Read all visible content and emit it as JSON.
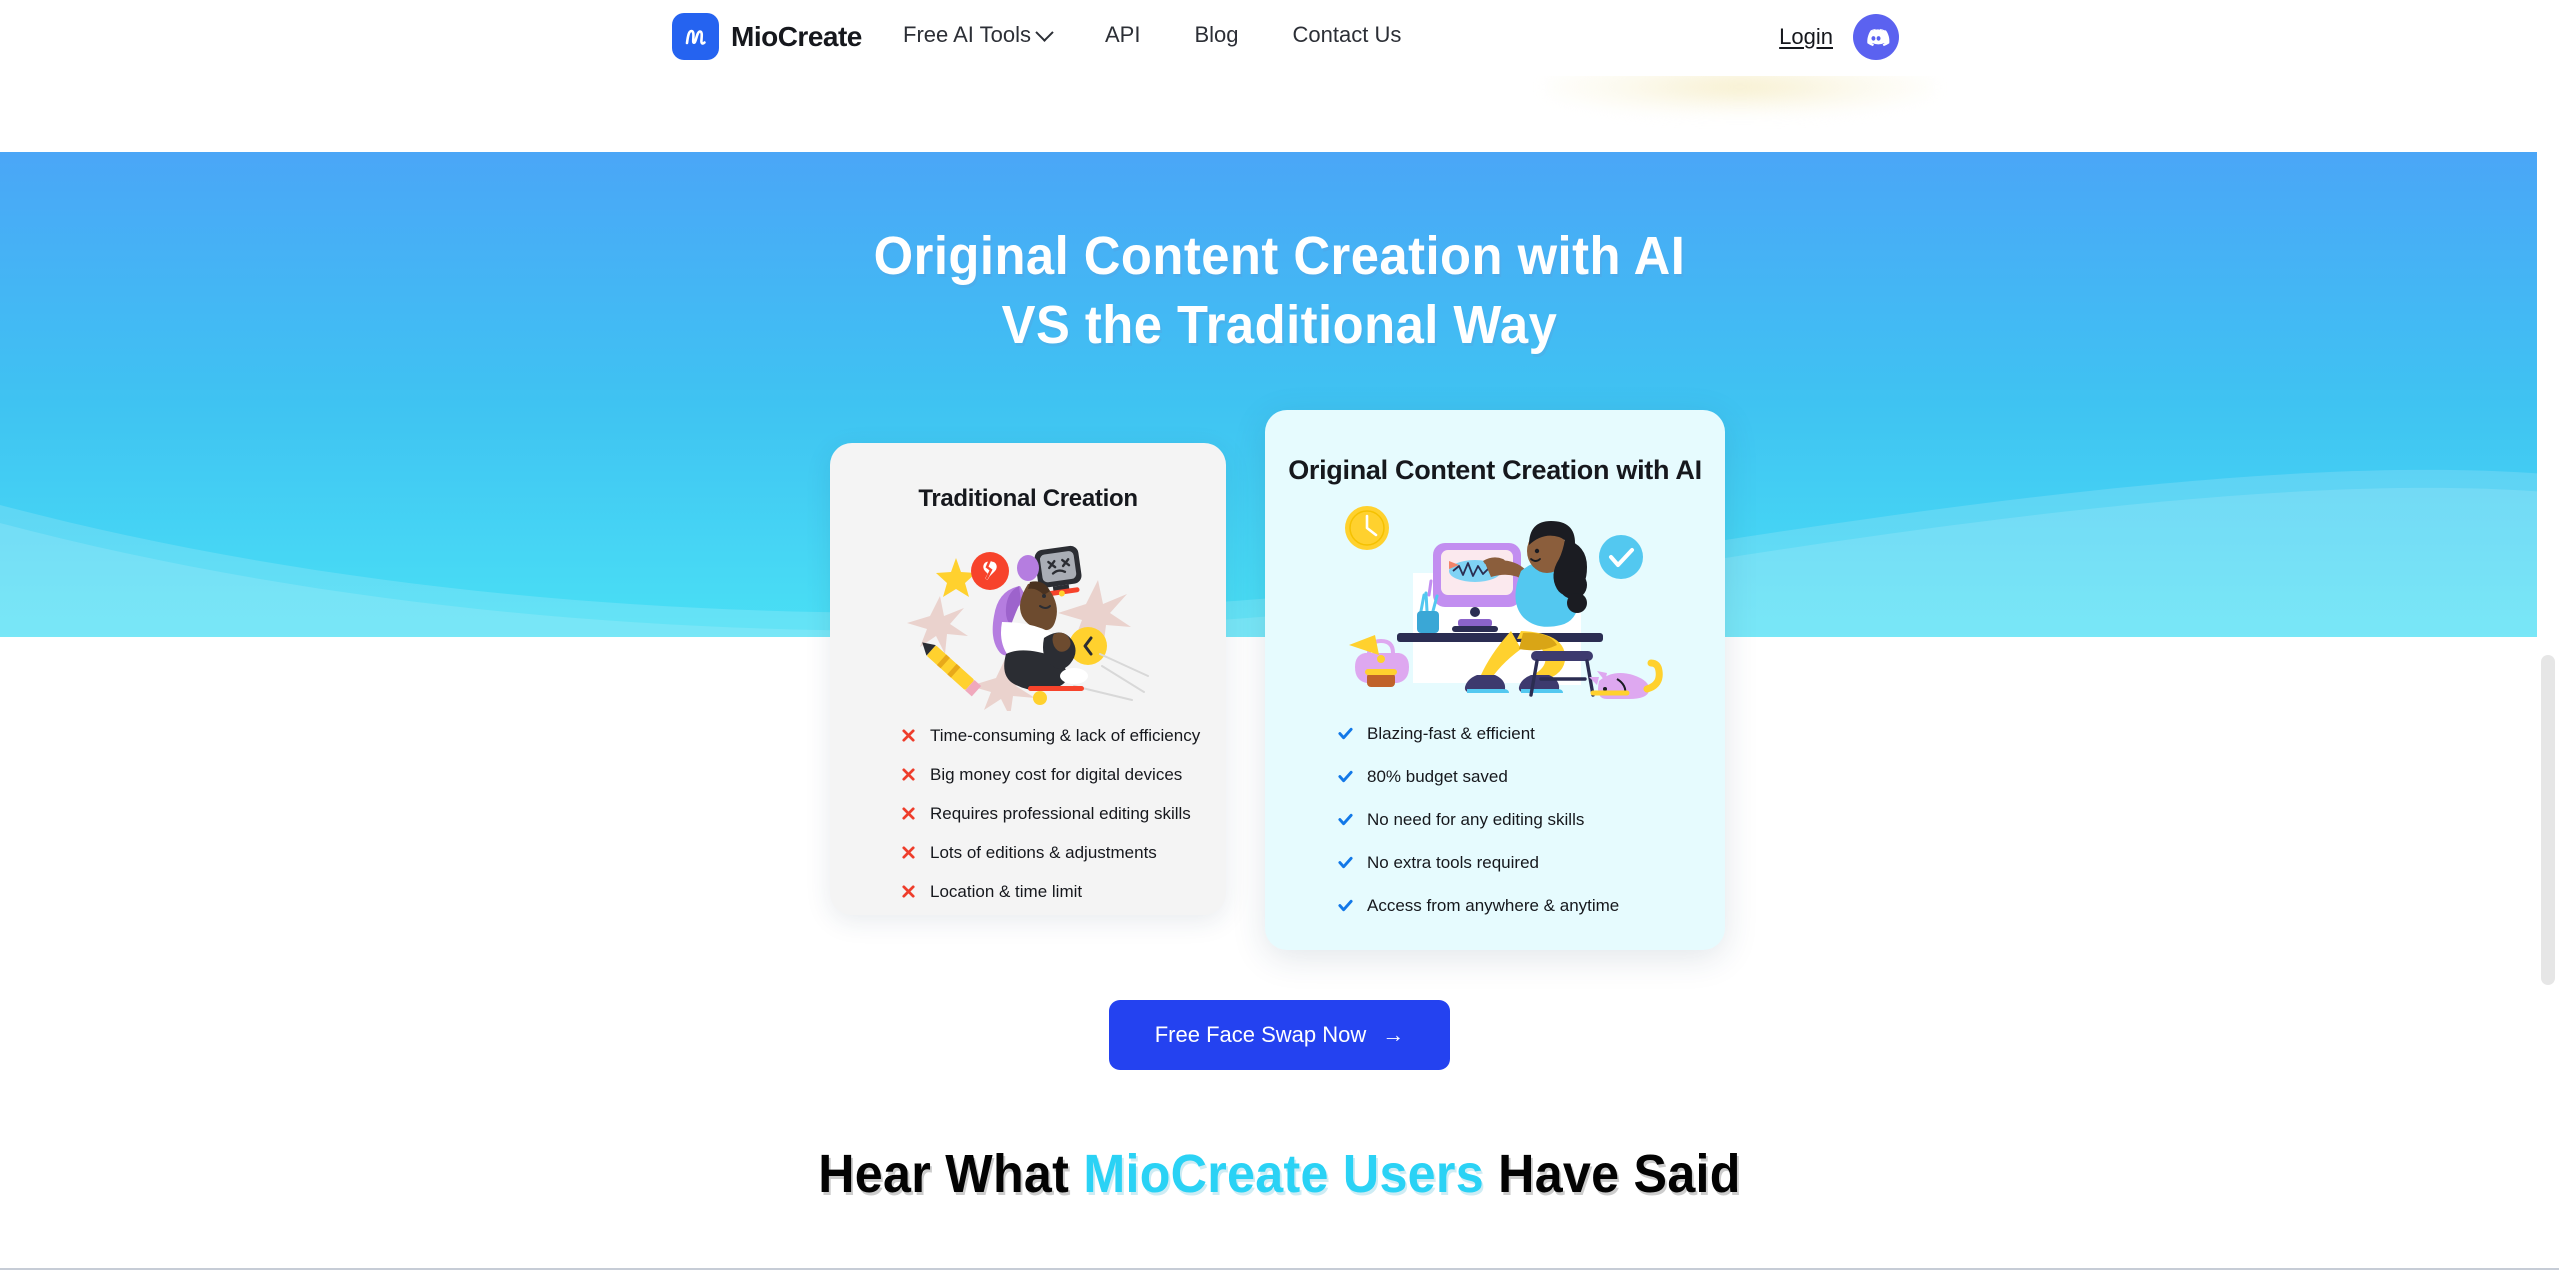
{
  "header": {
    "brand": {
      "name": "MioCreate",
      "mark_letter": "m",
      "mark_color": "#2563f0"
    },
    "nav": [
      {
        "label": "Free AI Tools",
        "has_dropdown": true
      },
      {
        "label": "API",
        "has_dropdown": false
      },
      {
        "label": "Blog",
        "has_dropdown": false
      },
      {
        "label": "Contact Us",
        "has_dropdown": false
      }
    ],
    "login_label": "Login",
    "discord_icon": "discord-icon"
  },
  "hero": {
    "title_line1": "Original Content Creation with AI",
    "title_line2": "VS the Traditional Way",
    "gradient_top": "#4aa6f7",
    "gradient_bottom": "#4ae0f5"
  },
  "comparison": {
    "traditional": {
      "title": "Traditional Creation",
      "card_color": "#f4f4f4",
      "mark_color": "#ee3d2b",
      "mark_icon": "cross-icon",
      "illustration": "frustrated-person-illustration",
      "items": [
        "Time-consuming & lack of efficiency",
        "Big money cost for digital devices",
        "Requires professional editing skills",
        "Lots of editions & adjustments",
        "Location & time limit"
      ]
    },
    "ai": {
      "title": "Original Content Creation with AI",
      "card_color": "#e6fbfe",
      "mark_color": "#1278e8",
      "mark_icon": "check-icon",
      "illustration": "person-at-desk-illustration",
      "items": [
        "Blazing-fast & efficient",
        "80% budget saved",
        "No need for any editing skills",
        "No extra tools required",
        "Access from anywhere & anytime"
      ]
    }
  },
  "cta": {
    "label": "Free Face Swap Now",
    "arrow": "→",
    "color": "#2442f0"
  },
  "testimonials": {
    "heading_before": "Hear What ",
    "heading_highlight": "MioCreate Users",
    "heading_after": " Have Said",
    "highlight_color": "#2ad2f5"
  }
}
